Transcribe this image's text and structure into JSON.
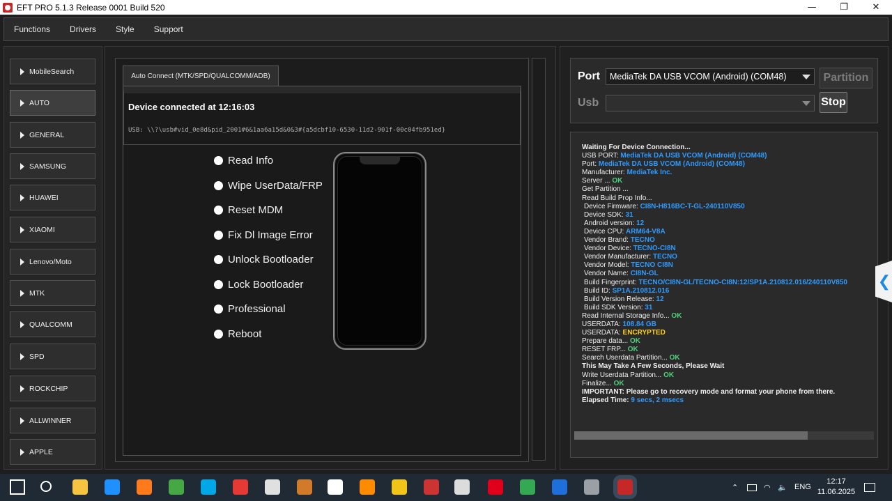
{
  "window": {
    "title": "EFT PRO 5.1.3 Release 0001 Build 520",
    "minimize": "—",
    "maximize": "❐",
    "close": "✕"
  },
  "menu": [
    "Functions",
    "Drivers",
    "Style",
    "Support"
  ],
  "sidebar": {
    "active": "AUTO",
    "items": [
      "MobileSearch",
      "AUTO",
      "GENERAL",
      "SAMSUNG",
      "HUAWEI",
      "XIAOMI",
      "Lenovo/Moto",
      "MTK",
      "QUALCOMM",
      "SPD",
      "ROCKCHIP",
      "ALLWINNER",
      "APPLE"
    ]
  },
  "center": {
    "tab_label": "Auto Connect (MTK/SPD/QUALCOMM/ADB)",
    "status_title": "Device connected at 12:16:03",
    "usb_path": "USB: \\\\?\\usb#vid_0e8d&pid_2001#6&1aa6a15d&0&3#{a5dcbf10-6530-11d2-901f-00c04fb951ed}",
    "options": [
      "Read Info",
      "Wipe UserData/FRP",
      "Reset MDM",
      "Fix Dl Image Error",
      "Unlock Bootloader",
      "Lock Bootloader",
      "Professional",
      "Reboot"
    ]
  },
  "port_panel": {
    "port_label": "Port",
    "port_value": "MediaTek DA USB VCOM (Android) (COM48)",
    "usb_label": "Usb",
    "usb_value": "",
    "partition_button": "Partition",
    "stop_button": "Stop"
  },
  "log": [
    [
      {
        "t": "Waiting For Device Connection...",
        "c": "b"
      }
    ],
    [
      {
        "t": "USB PORT: ",
        "c": ""
      },
      {
        "t": "MediaTek DA USB VCOM (Android) (COM48)",
        "c": "blue"
      }
    ],
    [
      {
        "t": "Port: ",
        "c": ""
      },
      {
        "t": "MediaTek DA USB VCOM (Android) (COM48)",
        "c": "blue"
      }
    ],
    [
      {
        "t": "Manufacturer: ",
        "c": ""
      },
      {
        "t": "MediaTek Inc.",
        "c": "blue"
      }
    ],
    [
      {
        "t": "Server ... ",
        "c": ""
      },
      {
        "t": "OK",
        "c": "green"
      }
    ],
    [
      {
        "t": "Get Partition ...",
        "c": ""
      }
    ],
    [
      {
        "t": "Read Build Prop Info...",
        "c": ""
      }
    ],
    [
      {
        "t": " Device Firmware: ",
        "c": "ind"
      },
      {
        "t": "CI8N-H816BC-T-GL-240110V850",
        "c": "blue"
      }
    ],
    [
      {
        "t": " Device SDK: ",
        "c": "ind"
      },
      {
        "t": "31",
        "c": "blue"
      }
    ],
    [
      {
        "t": " Android version: ",
        "c": "ind"
      },
      {
        "t": "12",
        "c": "blue"
      }
    ],
    [
      {
        "t": " Device CPU: ",
        "c": "ind"
      },
      {
        "t": "ARM64-V8A",
        "c": "blue"
      }
    ],
    [
      {
        "t": " Vendor Brand: ",
        "c": "ind"
      },
      {
        "t": "TECNO",
        "c": "blue"
      }
    ],
    [
      {
        "t": " Vendor Device: ",
        "c": "ind"
      },
      {
        "t": "TECNO-CI8N",
        "c": "blue"
      }
    ],
    [
      {
        "t": " Vendor Manufacturer: ",
        "c": "ind"
      },
      {
        "t": "TECNO",
        "c": "blue"
      }
    ],
    [
      {
        "t": " Vendor Model: ",
        "c": "ind"
      },
      {
        "t": "TECNO CI8N",
        "c": "blue"
      }
    ],
    [
      {
        "t": " Vendor Name: ",
        "c": "ind"
      },
      {
        "t": "CI8N-GL",
        "c": "blue"
      }
    ],
    [
      {
        "t": " Build Fingerprint: ",
        "c": "ind"
      },
      {
        "t": "TECNO/CI8N-GL/TECNO-CI8N:12/SP1A.210812.016/240110V850",
        "c": "blue"
      }
    ],
    [
      {
        "t": " Build ID: ",
        "c": "ind"
      },
      {
        "t": "SP1A.210812.016",
        "c": "blue"
      }
    ],
    [
      {
        "t": " Build Version Release: ",
        "c": "ind"
      },
      {
        "t": "12",
        "c": "blue"
      }
    ],
    [
      {
        "t": " Build SDK Version: ",
        "c": "ind"
      },
      {
        "t": "31",
        "c": "blue"
      }
    ],
    [
      {
        "t": "Read Internal Storage Info... ",
        "c": ""
      },
      {
        "t": "OK",
        "c": "green"
      }
    ],
    [
      {
        "t": "USERDATA: ",
        "c": ""
      },
      {
        "t": "108.84 GB",
        "c": "blue"
      }
    ],
    [
      {
        "t": "USERDATA: ",
        "c": ""
      },
      {
        "t": "ENCRYPTED",
        "c": "yellow"
      }
    ],
    [
      {
        "t": "Prepare data... ",
        "c": ""
      },
      {
        "t": "OK",
        "c": "green"
      }
    ],
    [
      {
        "t": "RESET FRP... ",
        "c": ""
      },
      {
        "t": "OK",
        "c": "green"
      }
    ],
    [
      {
        "t": "Search Userdata Partition... ",
        "c": ""
      },
      {
        "t": "OK",
        "c": "green"
      }
    ],
    [
      {
        "t": "This May Take A Few Seconds, Please Wait",
        "c": "b"
      }
    ],
    [
      {
        "t": "Write Userdata Partition... ",
        "c": ""
      },
      {
        "t": "OK",
        "c": "green"
      }
    ],
    [
      {
        "t": "Finalize... ",
        "c": ""
      },
      {
        "t": "OK",
        "c": "green"
      }
    ],
    [
      {
        "t": "IMPORTANT: Please go to recovery mode and format your phone from there.",
        "c": "b"
      }
    ],
    [
      {
        "t": "Elapsed Time: ",
        "c": "b"
      },
      {
        "t": "9 secs, 2 msecs",
        "c": "blue"
      }
    ]
  ],
  "progress_fraction": 0.78,
  "side_handle": "❮",
  "taskbar": {
    "icons": [
      "windows-start",
      "search",
      "file-explorer",
      "edge",
      "firefox",
      "utorrent",
      "skype",
      "chrome",
      "camera",
      "gimp",
      "media-player",
      "vlc",
      "archive",
      "settings-tool",
      "calculator",
      "opera",
      "chrome-2",
      "teamviewer",
      "network-tool",
      "eft-pro"
    ],
    "language": "ENG",
    "time": "12:17",
    "date": "11.06.2025"
  }
}
